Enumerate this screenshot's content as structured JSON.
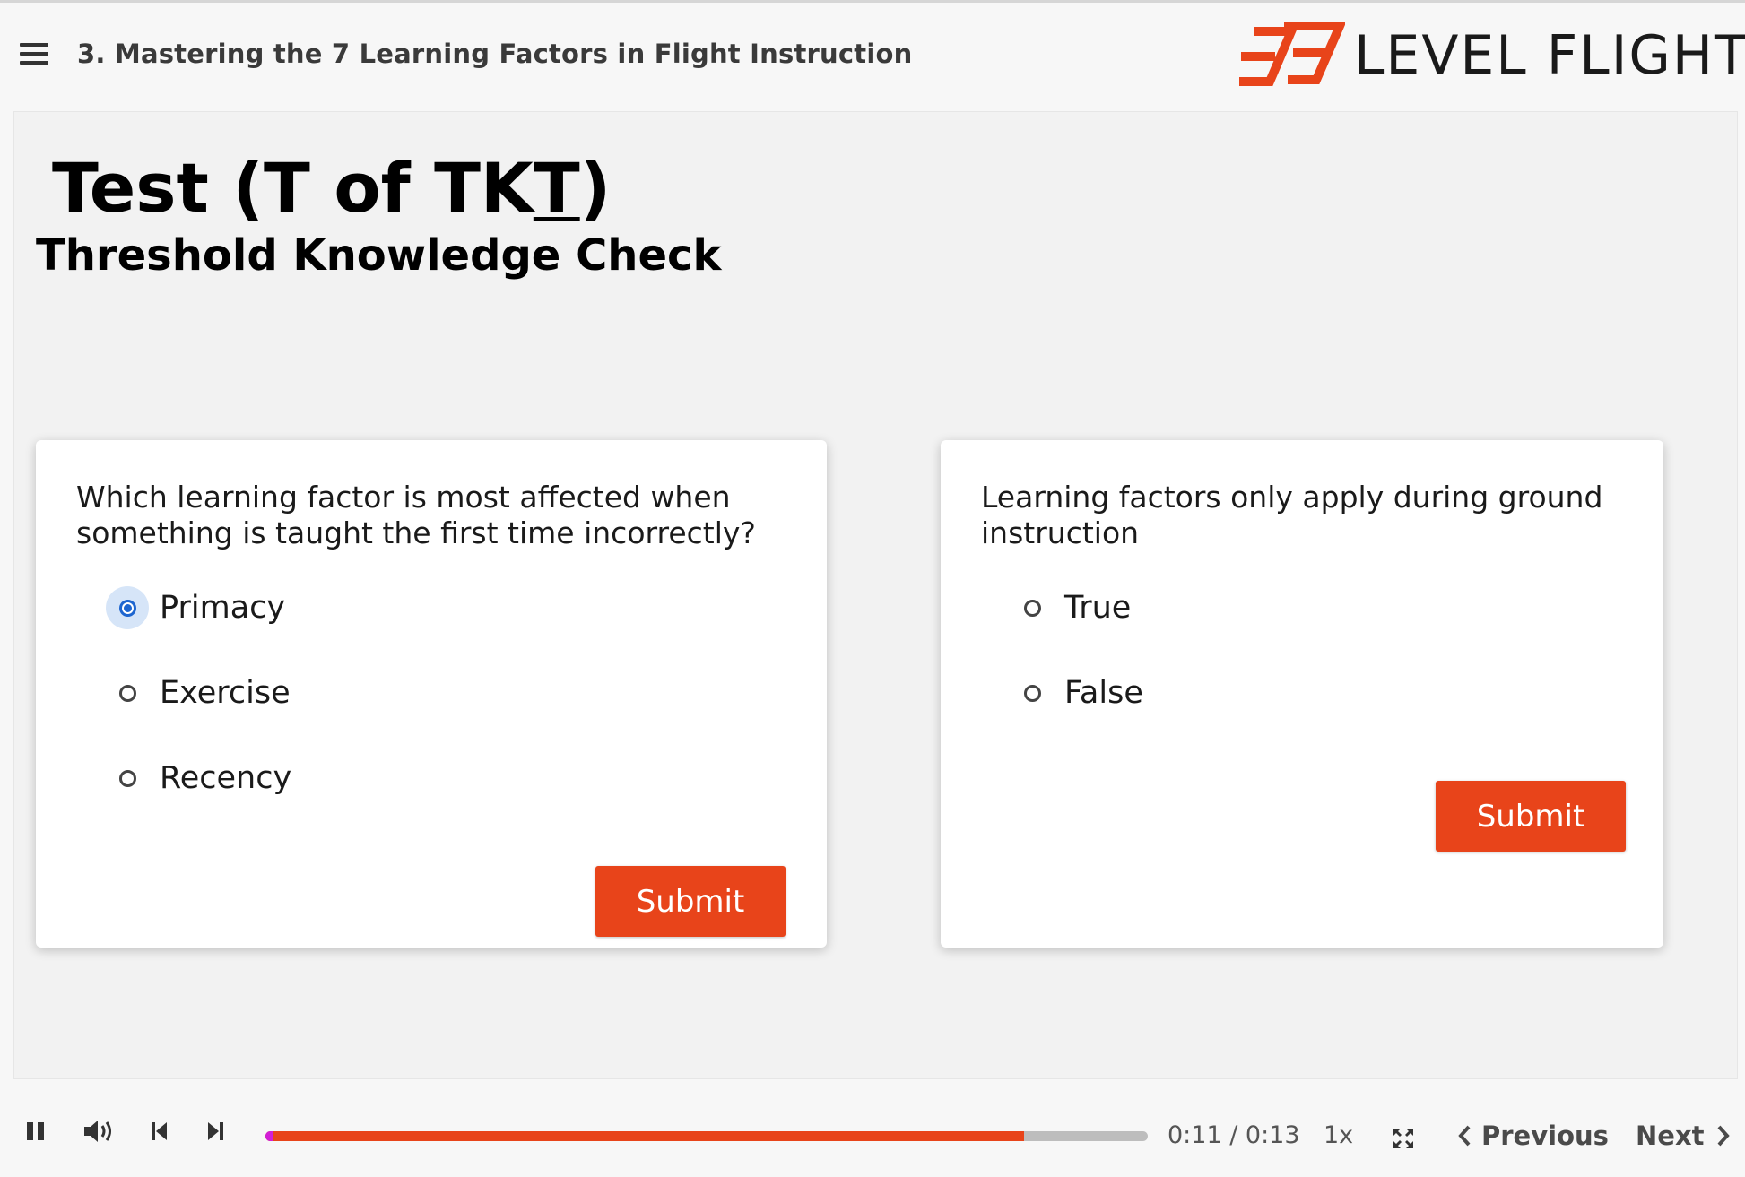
{
  "header": {
    "course_title": "3. Mastering the 7 Learning Factors in Flight Instruction",
    "logo_text": "LEVEL FLIGHT",
    "brand_color": "#e8441a"
  },
  "slide": {
    "title_prefix": "Test (T of TK",
    "title_underlined": "T",
    "title_suffix": ")",
    "subtitle": "Threshold Knowledge Check"
  },
  "question1": {
    "text": "Which learning factor is most affected when something is taught the first time incorrectly?",
    "options": [
      {
        "label": "Primacy",
        "selected": true
      },
      {
        "label": "Exercise",
        "selected": false
      },
      {
        "label": "Recency",
        "selected": false
      }
    ],
    "submit_label": "Submit"
  },
  "question2": {
    "text": "Learning factors only apply during ground instruction",
    "options": [
      {
        "label": "True",
        "selected": false
      },
      {
        "label": "False",
        "selected": false
      }
    ],
    "submit_label": "Submit"
  },
  "player": {
    "time": "0:11 / 0:13",
    "speed": "1x",
    "progress_fraction": 0.86,
    "previous_label": "Previous",
    "next_label": "Next",
    "icons": [
      "pause-icon",
      "volume-icon",
      "skip-back-icon",
      "skip-forward-icon",
      "fullscreen-icon"
    ]
  }
}
